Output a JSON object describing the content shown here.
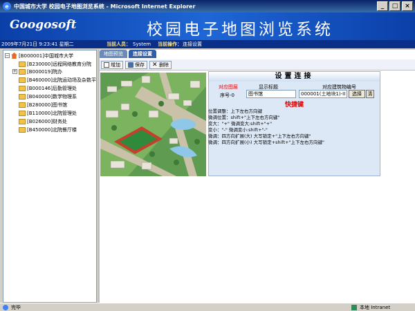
{
  "window": {
    "title": "中国城市大学 校园电子地图浏览系统 - Microsoft Internet Explorer",
    "buttons": [
      "_",
      "□",
      "×"
    ]
  },
  "banner": {
    "logo": "Googosoft",
    "system_title": "校园电子地图浏览系统"
  },
  "infobar": {
    "datetime": "2009年7月21日 9:23:41 星期二",
    "user_label": "当前人员：",
    "user_value": "System",
    "op_label": "当前操作：",
    "op_value": "连接设置"
  },
  "tree": {
    "root": "[B000001]中国城市大学",
    "items": [
      "[B230000]远程网络教育分院",
      "[B000019]院办",
      "[B460000]北院运动场及杂数平房",
      "[B000146]后勤管理处",
      "[B040000]数学物理系",
      "[B280000]图书馆",
      "[B110000]北院管理处",
      "[B026000]财务处",
      "[B450000]北院餐厅楼"
    ]
  },
  "tabs": [
    {
      "label": "地图预览",
      "active": false
    },
    {
      "label": "连接设置",
      "active": true
    }
  ],
  "toolbar": {
    "add": "增加",
    "save": "保存",
    "delete": "删除"
  },
  "panel": {
    "title": "设置连接",
    "col_layer": "对应图层",
    "col_display": "显示标题",
    "col_building": "对应建筑物编号",
    "row_label": "序号-0",
    "display_value": "图书馆",
    "building_value": "000001(土地块1)-II",
    "select_btn": "选择",
    "clear_btn": "清",
    "shortcut_title": "快捷键",
    "help_lines": [
      "位置调整：上下左右方向键",
      "微调位置：shift+\"上下左右方向键\"",
      "变大：\"+\"  微调变大:shift+\"+\"",
      "变小：\"-\"  微调变小:shift+\"-\"",
      "微调：四方向扩展(大)  大写锁定+\"上下左右方向键\"",
      "微调：四方向扩展(小)  大写锁定+shift+\"上下左右方向键\""
    ]
  },
  "statusbar": {
    "status": "完毕",
    "zone": "本地 Intranet"
  },
  "colors": {
    "banner": "#1e66d6",
    "accent_red": "#e00000"
  }
}
